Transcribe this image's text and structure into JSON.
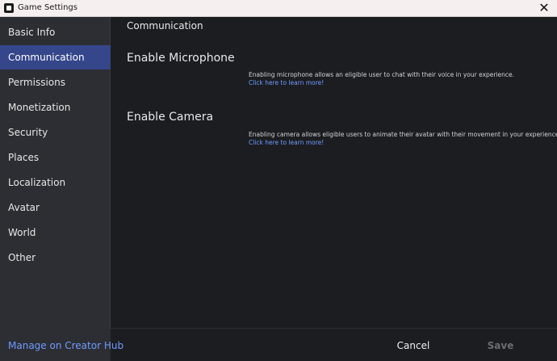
{
  "window": {
    "title": "Game Settings",
    "close_symbol": "✕"
  },
  "sidebar": {
    "items": [
      {
        "label": "Basic Info",
        "active": false
      },
      {
        "label": "Communication",
        "active": true
      },
      {
        "label": "Permissions",
        "active": false
      },
      {
        "label": "Monetization",
        "active": false
      },
      {
        "label": "Security",
        "active": false
      },
      {
        "label": "Places",
        "active": false
      },
      {
        "label": "Localization",
        "active": false
      },
      {
        "label": "Avatar",
        "active": false
      },
      {
        "label": "World",
        "active": false
      },
      {
        "label": "Other",
        "active": false
      }
    ]
  },
  "main": {
    "page_title": "Communication",
    "sections": [
      {
        "title": "Enable Microphone",
        "description": "Enabling microphone allows an eligible user to chat with their voice in your experience.",
        "link": "Click here to learn more!"
      },
      {
        "title": "Enable Camera",
        "description": "Enabling camera allows eligible users to animate their avatar with their movement in your experience.",
        "link": "Click here to learn more!"
      }
    ]
  },
  "footer": {
    "creator_hub_link": "Manage on Creator Hub",
    "cancel_label": "Cancel",
    "save_label": "Save"
  },
  "colors": {
    "accent": "#35468b",
    "link": "#6e9bff",
    "background": "#1c1d21",
    "sidebar": "#2d2e33"
  }
}
